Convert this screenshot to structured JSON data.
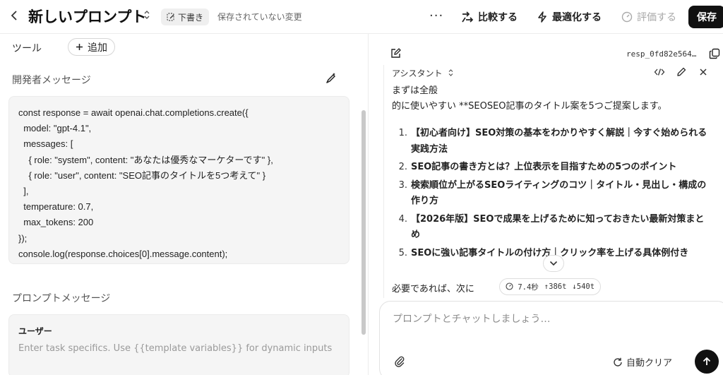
{
  "header": {
    "back_icon": "chevron-left-icon",
    "title": "新しいプロンプト",
    "draft_label": "下書き",
    "unsaved_label": "保存されていない変更",
    "more_label": "···",
    "compare_label": "比較する",
    "optimize_label": "最適化する",
    "evaluate_label": "評価する",
    "save_label": "保存"
  },
  "left": {
    "tools_label": "ツール",
    "add_label": "追加",
    "developer_label": "開発者メッセージ",
    "code_lines": [
      "const response = await openai.chat.completions.create({",
      "  model: \"gpt-4.1\",",
      "  messages: [",
      "    { role: \"system\", content: \"あなたは優秀なマーケターです\" },",
      "    { role: \"user\", content: \"SEO記事のタイトルを5つ考えて\" }",
      "  ],",
      "  temperature: 0.7,",
      "  max_tokens: 200",
      "});",
      "console.log(response.choices[0].message.content);"
    ],
    "prompt_label": "プロンプトメッセージ",
    "user_role": "ユーザー",
    "user_placeholder": "Enter task specifics. Use {{template variables}} for dynamic inputs"
  },
  "right": {
    "response_id": "resp_0fd82e564…",
    "assistant_label": "アシスタント",
    "intro_line1": "まずは全般",
    "intro_line2": "的に使いやすい **SEOSEO記事のタイトル案を5つご提案します。",
    "items": [
      {
        "num": "1.",
        "text": "【初心者向け】SEO対策の基本をわかりやすく解説｜今すぐ始められる実践方法"
      },
      {
        "num": "2.",
        "text": "SEO記事の書き方とは？上位表示を目指すための5つのポイント"
      },
      {
        "num": "3.",
        "text": "検索順位が上がるSEOライティングのコツ｜タイトル・見出し・構成の作り方"
      },
      {
        "num": "4.",
        "text": "【2026年版】SEOで成果を上げるために知っておきたい最新対策まとめ"
      },
      {
        "num": "5.",
        "text": "SEOに強い記事タイトルの付け方｜クリック率を上げる具体例付き"
      }
    ],
    "tail_text": "必要であれば、次に",
    "stats": {
      "time": "7.4秒",
      "input_tokens": "386t",
      "output_tokens": "540t"
    },
    "chat_placeholder": "プロンプトとチャットしましょう…",
    "autoclear_label": "自動クリア"
  },
  "colors": {
    "accent_dark": "#111111",
    "muted": "#9a9a9a",
    "panel_bg": "#f5f5f5"
  }
}
